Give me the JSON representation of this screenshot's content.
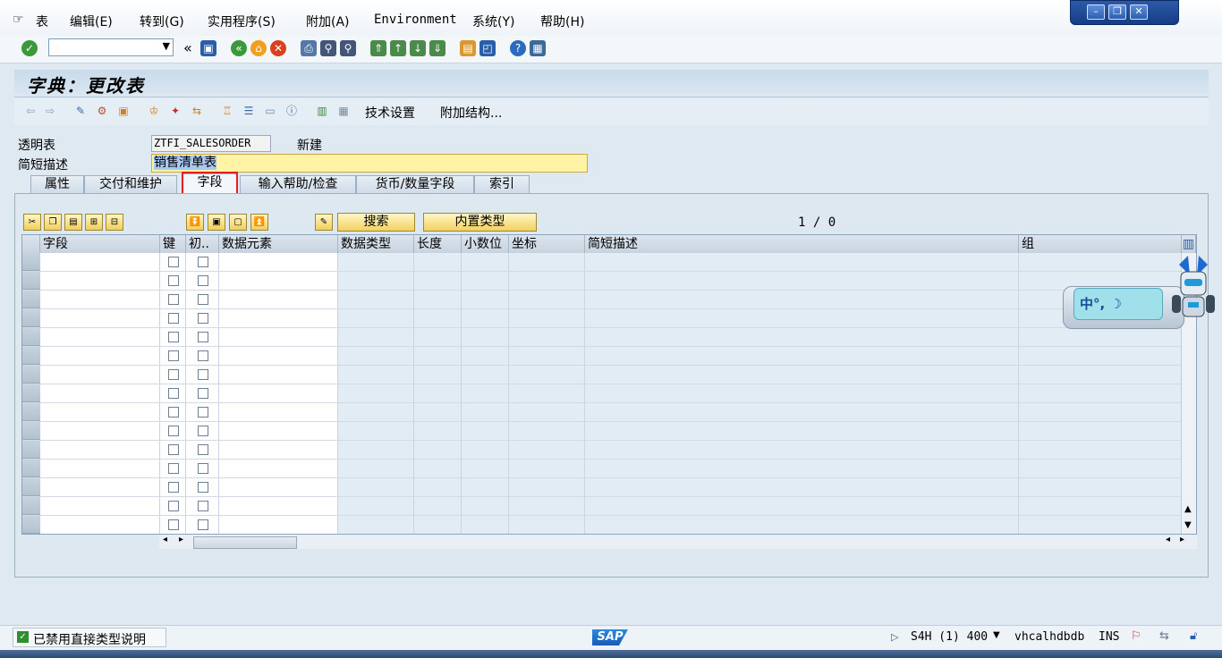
{
  "menu": {
    "items": [
      "表",
      "编辑(E)",
      "转到(G)",
      "实用程序(S)",
      "附加(A)",
      "Environment",
      "系统(Y)",
      "帮助(H)"
    ]
  },
  "window_controls": [
    "minimize",
    "restore",
    "close"
  ],
  "toolbar": {
    "back_symbol": "«"
  },
  "title": "字典：更改表",
  "app_toolbar": {
    "tech_settings": "技术设置",
    "append_structure": "附加结构..."
  },
  "header": {
    "table_label": "透明表",
    "table_name": "ZTFI_SALESORDER",
    "table_status": "新建",
    "desc_label": "简短描述",
    "desc_value": "销售清单表"
  },
  "tabs": [
    {
      "label": "属性",
      "active": false
    },
    {
      "label": "交付和维护",
      "active": false
    },
    {
      "label": "字段",
      "active": true
    },
    {
      "label": "输入帮助/检查",
      "active": false
    },
    {
      "label": "货币/数量字段",
      "active": false
    },
    {
      "label": "索引",
      "active": false
    }
  ],
  "table_toolbar": {
    "search": "搜索",
    "builtin_type": "内置类型",
    "position": "1 / 0"
  },
  "grid": {
    "columns": [
      "字段",
      "键",
      "初..",
      "数据元素",
      "数据类型",
      "长度",
      "小数位",
      "坐标",
      "简短描述",
      "组"
    ]
  },
  "status": {
    "message": "已禁用直接类型说明",
    "sap_logo": "SAP",
    "system": "S4H (1) 400",
    "host": "vhcalhdbdb",
    "mode": "INS"
  },
  "ime": {
    "text": "中°,"
  },
  "colors": {
    "accent": "#153d85",
    "title_bg": "#c8dbea",
    "highlight_red": "#e02020",
    "desc_field": "#fff3a6"
  }
}
